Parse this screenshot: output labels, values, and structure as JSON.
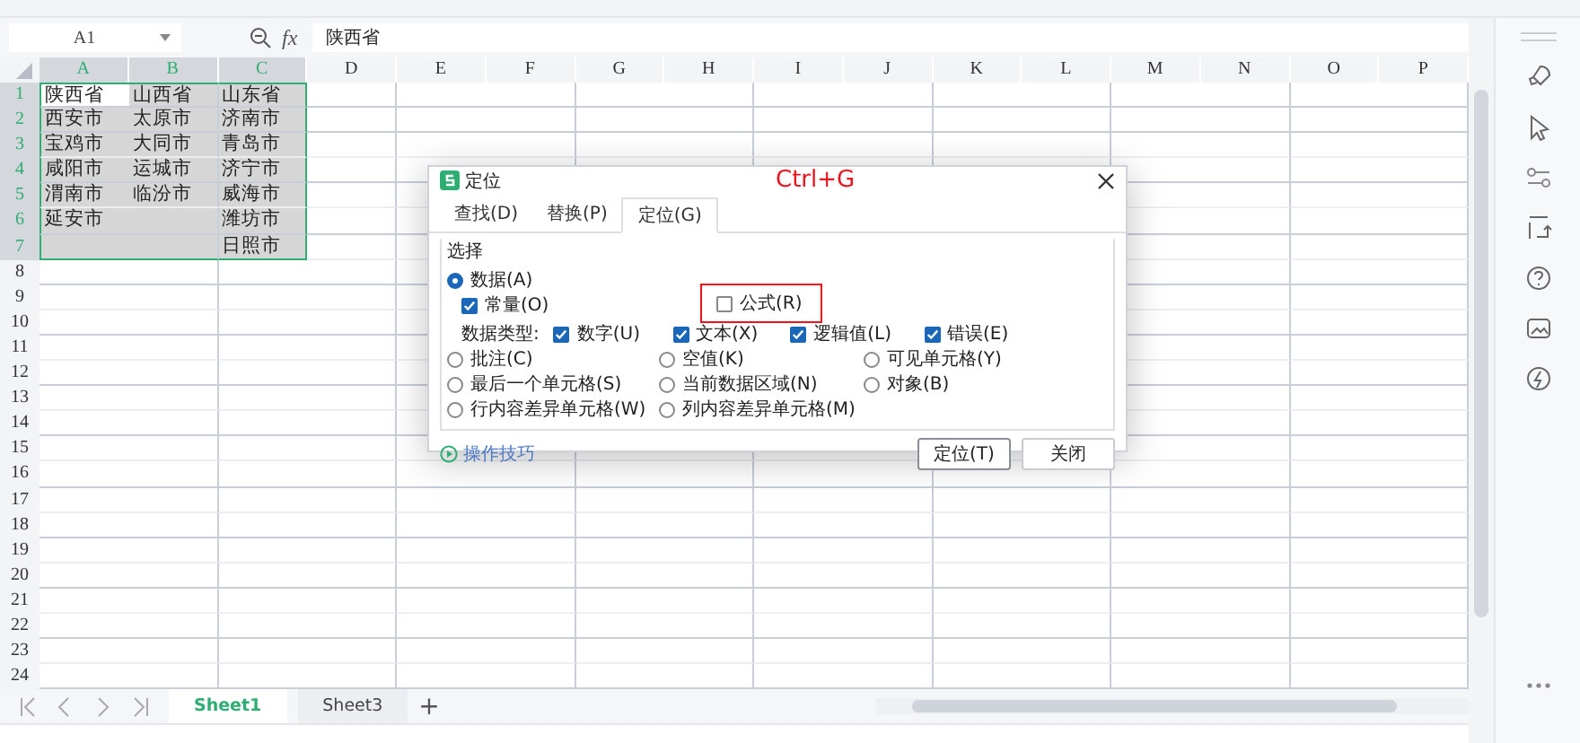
{
  "formula_bar": {
    "name_box": "A1",
    "fx_label": "fx",
    "value": "陕西省"
  },
  "sheet": {
    "columns": [
      {
        "label": "A",
        "selected": true
      },
      {
        "label": "B",
        "selected": true
      },
      {
        "label": "C",
        "selected": true
      },
      {
        "label": "D",
        "selected": false
      },
      {
        "label": "E",
        "selected": false
      },
      {
        "label": "F",
        "selected": false
      },
      {
        "label": "G",
        "selected": false
      },
      {
        "label": "H",
        "selected": false
      },
      {
        "label": "I",
        "selected": false
      },
      {
        "label": "J",
        "selected": false
      },
      {
        "label": "K",
        "selected": false
      },
      {
        "label": "L",
        "selected": false
      },
      {
        "label": "M",
        "selected": false
      },
      {
        "label": "N",
        "selected": false
      },
      {
        "label": "O",
        "selected": false
      },
      {
        "label": "P",
        "selected": false
      }
    ],
    "rows": [
      {
        "label": "1",
        "selected": true,
        "cells": [
          "陕西省",
          "山西省",
          "山东省"
        ]
      },
      {
        "label": "2",
        "selected": true,
        "cells": [
          "西安市",
          "太原市",
          "济南市"
        ]
      },
      {
        "label": "3",
        "selected": true,
        "cells": [
          "宝鸡市",
          "大同市",
          "青岛市"
        ]
      },
      {
        "label": "4",
        "selected": true,
        "cells": [
          "咸阳市",
          "运城市",
          "济宁市"
        ]
      },
      {
        "label": "5",
        "selected": true,
        "cells": [
          "渭南市",
          "临汾市",
          "威海市"
        ]
      },
      {
        "label": "6",
        "selected": true,
        "cells": [
          "延安市",
          "",
          "潍坊市"
        ]
      },
      {
        "label": "7",
        "selected": true,
        "cells": [
          "",
          "",
          "日照市"
        ]
      },
      {
        "label": "8",
        "selected": false,
        "cells": []
      },
      {
        "label": "9",
        "selected": false,
        "cells": []
      },
      {
        "label": "10",
        "selected": false,
        "cells": []
      },
      {
        "label": "11",
        "selected": false,
        "cells": []
      },
      {
        "label": "12",
        "selected": false,
        "cells": []
      },
      {
        "label": "13",
        "selected": false,
        "cells": []
      },
      {
        "label": "14",
        "selected": false,
        "cells": []
      },
      {
        "label": "15",
        "selected": false,
        "cells": []
      },
      {
        "label": "16",
        "selected": false,
        "cells": []
      },
      {
        "label": "17",
        "selected": false,
        "cells": []
      },
      {
        "label": "18",
        "selected": false,
        "cells": []
      },
      {
        "label": "19",
        "selected": false,
        "cells": []
      },
      {
        "label": "20",
        "selected": false,
        "cells": []
      },
      {
        "label": "21",
        "selected": false,
        "cells": []
      },
      {
        "label": "22",
        "selected": false,
        "cells": []
      },
      {
        "label": "23",
        "selected": false,
        "cells": []
      },
      {
        "label": "24",
        "selected": false,
        "cells": []
      }
    ]
  },
  "sheet_tabs": [
    {
      "label": "Sheet1",
      "selected": true
    },
    {
      "label": "Sheet3",
      "selected": false
    }
  ],
  "add_sheet": "+",
  "dialog": {
    "title": "定位",
    "annotation": "Ctrl+G",
    "tabs": [
      {
        "label": "查找(D)",
        "selected": false
      },
      {
        "label": "替换(P)",
        "selected": false
      },
      {
        "label": "定位(G)",
        "selected": true
      }
    ],
    "group_label": "选择",
    "data_option": {
      "label": "数据(A)",
      "selected": true
    },
    "data_checks": [
      {
        "label": "常量(O)",
        "checked": true,
        "highlighted": false
      },
      {
        "label": "公式(R)",
        "checked": false,
        "highlighted": true
      }
    ],
    "data_type_label": "数据类型:",
    "data_types": [
      {
        "label": "数字(U)",
        "checked": true
      },
      {
        "label": "文本(X)",
        "checked": true
      },
      {
        "label": "逻辑值(L)",
        "checked": true
      },
      {
        "label": "错误(E)",
        "checked": true
      }
    ],
    "other_options": [
      {
        "label": "批注(C)",
        "selected": false
      },
      {
        "label": "空值(K)",
        "selected": false
      },
      {
        "label": "可见单元格(Y)",
        "selected": false
      },
      {
        "label": "最后一个单元格(S)",
        "selected": false
      },
      {
        "label": "当前数据区域(N)",
        "selected": false
      },
      {
        "label": "对象(B)",
        "selected": false
      },
      {
        "label": "行内容差异单元格(W)",
        "selected": false
      },
      {
        "label": "列内容差异单元格(M)",
        "selected": false
      }
    ],
    "tips_link": "操作技巧",
    "buttons": [
      {
        "label": "定位(T)",
        "kind": "primary"
      },
      {
        "label": "关闭",
        "kind": "normal"
      }
    ]
  }
}
